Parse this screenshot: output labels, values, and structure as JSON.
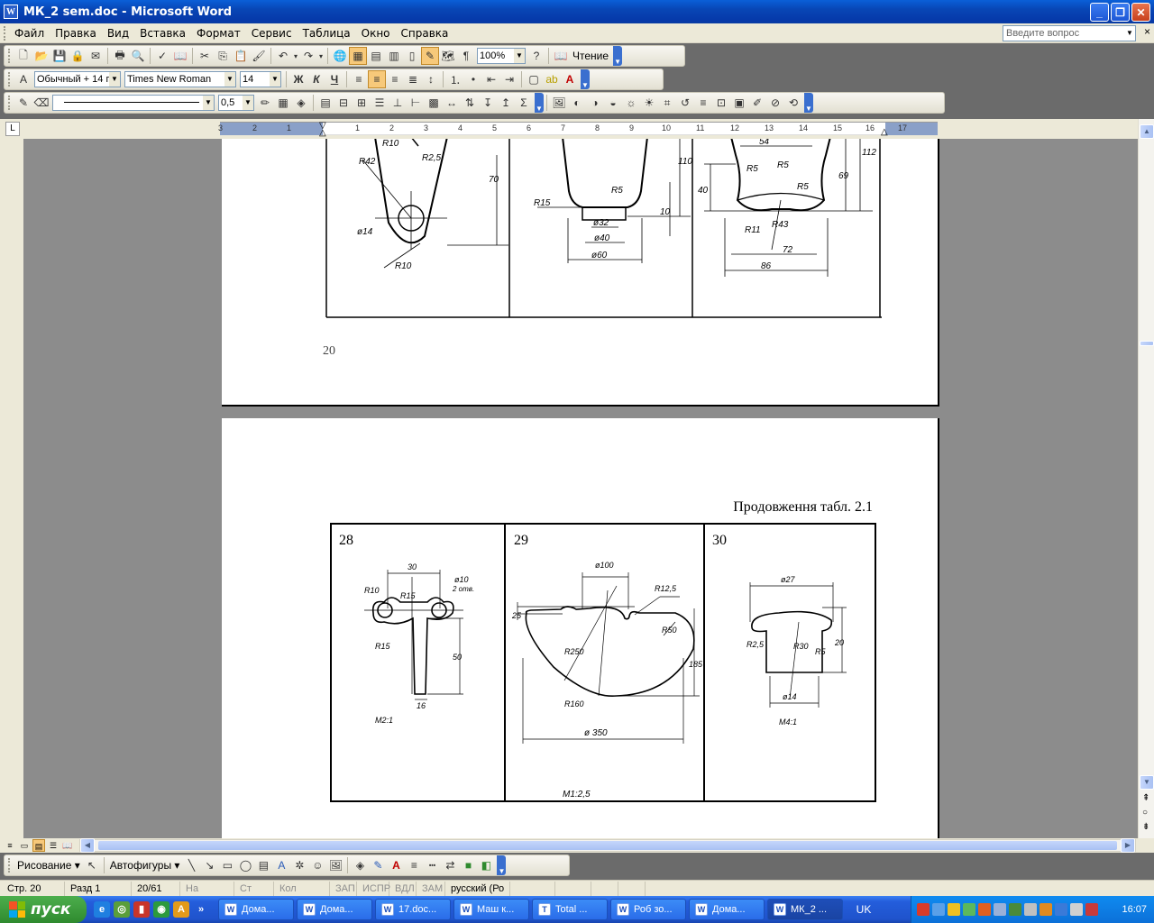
{
  "window": {
    "title": "МК_2 sem.doc - Microsoft Word",
    "icon_label": "W"
  },
  "menu": {
    "items": [
      "Файл",
      "Правка",
      "Вид",
      "Вставка",
      "Формат",
      "Сервис",
      "Таблица",
      "Окно",
      "Справка"
    ],
    "help_placeholder": "Введите вопрос",
    "close_glyph": "×"
  },
  "toolbar_standard": {
    "zoom": "100%",
    "reading_label": "Чтение"
  },
  "toolbar_formatting": {
    "style": "Обычный + 14 г",
    "font": "Times New Roman",
    "size": "14",
    "bold": "Ж",
    "italic": "К",
    "underline": "Ч"
  },
  "toolbar_tables": {
    "line_weight": "0,5"
  },
  "ruler": {
    "tab_glyph": "L",
    "numbers": [
      "3",
      "2",
      "1",
      "1",
      "2",
      "3",
      "4",
      "5",
      "6",
      "7",
      "8",
      "9",
      "10",
      "11",
      "12",
      "13",
      "14",
      "15",
      "16",
      "17"
    ]
  },
  "page1": {
    "page_number": "20",
    "dims": {
      "r10": "R10",
      "r42": "R42",
      "r25": "R2,5",
      "d14": "ø14",
      "r10b": "R10",
      "h70": "70",
      "r15": "R15",
      "r5": "R5",
      "d32": "ø32",
      "d40": "ø40",
      "d60": "ø60",
      "h110": "110",
      "h10": "10",
      "w54": "54",
      "r5a": "R5",
      "r5b": "R5",
      "r5c": "R5",
      "h40": "40",
      "r11": "R11",
      "r43": "R43",
      "w72": "72",
      "w86": "86",
      "h69": "69",
      "h112": "112"
    }
  },
  "page2": {
    "caption": "Продовження табл. 2.1",
    "cells": [
      {
        "number": "28",
        "dims": {
          "w30": "30",
          "r10": "R10",
          "r15": "R15",
          "d10": "ø10",
          "holes": "2 отв.",
          "r15b": "R15",
          "h50": "50",
          "w16": "16"
        },
        "scale": "M2:1"
      },
      {
        "number": "29",
        "dims": {
          "d100": "ø100",
          "r125": "R12,5",
          "h25": "25",
          "r50": "R50",
          "r250": "R250",
          "h185": "185",
          "r160": "R160",
          "d350": "ø 350"
        },
        "scale": "M1:2,5"
      },
      {
        "number": "30",
        "dims": {
          "d27": "ø27",
          "r25": "R2,5",
          "r30": "R30",
          "r5": "R5",
          "h20": "20",
          "d14": "ø14"
        },
        "scale": "M4:1"
      }
    ]
  },
  "drawing_toolbar": {
    "draw_label": "Рисование",
    "autoshapes_label": "Автофигуры"
  },
  "status": {
    "page": "Стр. 20",
    "section": "Разд 1",
    "pages": "20/61",
    "at": "На",
    "line": "Ст",
    "col": "Кол",
    "rec": "ЗАП",
    "trk": "ИСПР",
    "ext": "ВДЛ",
    "ovr": "ЗАМ",
    "language": "русский (Ро"
  },
  "taskbar": {
    "start_label": "пуск",
    "tasks": [
      "Дома...",
      "Дома...",
      "17.doc...",
      "Маш к...",
      "Total ...",
      "Роб зо...",
      "Дома...",
      "МК_2 ..."
    ],
    "language": "UK",
    "clock": "16:07"
  },
  "colors": {
    "title_bar": "#0846b5",
    "face": "#ece9d8",
    "taskbar": "#245edc",
    "start": "#2f8a2f"
  }
}
